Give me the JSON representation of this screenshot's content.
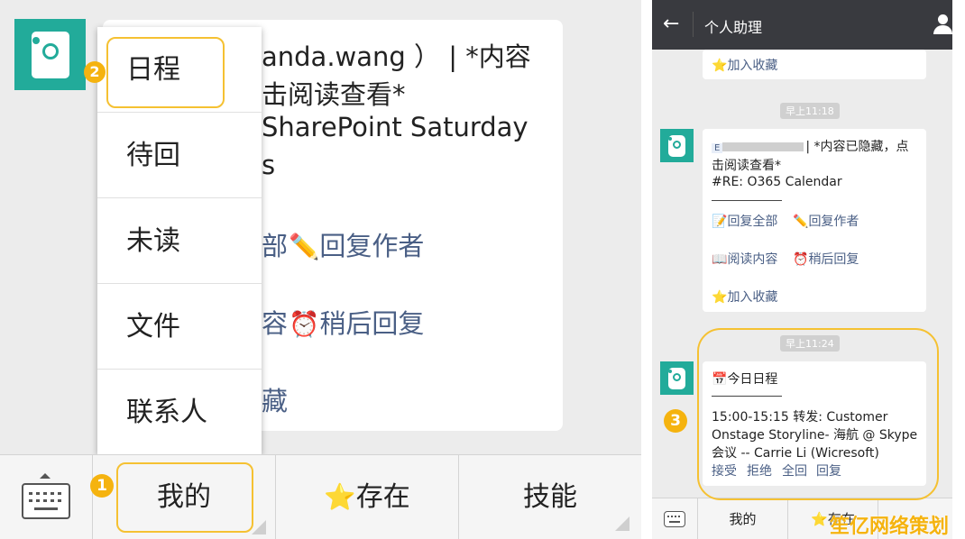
{
  "left_panel": {
    "bubble_lines": [
      "anda.wang ） | *内容",
      "击阅读查看*",
      " SharePoint Saturday",
      "s"
    ],
    "bubble_action1_prefix": "部",
    "bubble_action1": "回复作者",
    "bubble_action2_prefix": "容",
    "bubble_action2": "稍后回复",
    "bubble_action3_prefix": "藏",
    "menu_items": [
      "日程",
      "待回",
      "未读",
      "文件",
      "联系人"
    ],
    "badge_menu": "2",
    "badge_mine": "1",
    "bottom_bar": {
      "mine": "我的",
      "saved": "存在",
      "skills": "技能"
    }
  },
  "right_panel": {
    "title": "个人助理",
    "msg1_action": "加入收藏",
    "time1": "早上11:18",
    "msg2": {
      "sender_prefix": "E",
      "line1_tail": "| *内容已隐藏，点",
      "line2": "击阅读查看*",
      "line3": "#RE: O365 Calendar",
      "actions": [
        "回复全部",
        "回复作者",
        "阅读内容",
        "稍后回复",
        "加入收藏"
      ]
    },
    "time2": "早上11:24",
    "msg3": {
      "title": "今日日程",
      "line1": "15:00-15:15 转发: Customer",
      "line2": "Onstage Storyline- 海航 @ Skype",
      "line3": "会议 -- Carrie Li (Wicresoft)",
      "actions": [
        "接受",
        "拒绝",
        "全回",
        "回复"
      ]
    },
    "badge": "3",
    "bottom_bar": {
      "mine": "我的",
      "saved": "存在"
    }
  },
  "watermark": "笙亿网络策划",
  "colors": {
    "accent": "#22ab9a",
    "highlight": "#f5c132",
    "badge": "#f5b30f",
    "titlebar": "#393a3f",
    "link": "#4a5f85"
  }
}
